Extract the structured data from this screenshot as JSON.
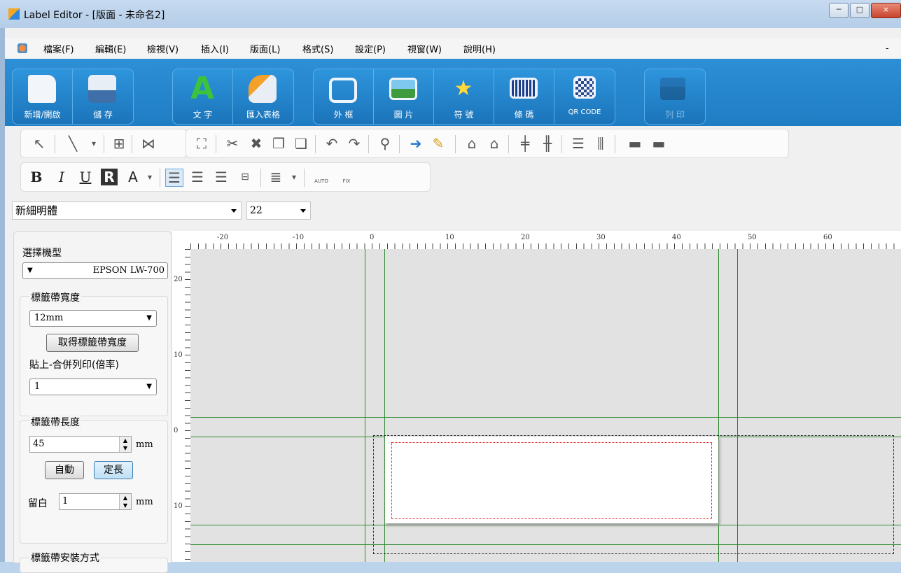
{
  "window": {
    "title": "Label Editor - [版面 - 未命名2]",
    "controls": [
      "─",
      "□",
      "×"
    ]
  },
  "menu": [
    "檔案(F)",
    "編輯(E)",
    "檢視(V)",
    "插入(I)",
    "版面(L)",
    "格式(S)",
    "設定(P)",
    "視窗(W)",
    "說明(H)"
  ],
  "ribbon": {
    "groups": [
      [
        {
          "label": "新增/開啟",
          "icon": "new-open-icon"
        },
        {
          "label": "儲 存",
          "icon": "save-icon"
        }
      ],
      [
        {
          "label": "文 字",
          "icon": "text-icon"
        },
        {
          "label": "匯入表格",
          "icon": "import-table-icon"
        }
      ],
      [
        {
          "label": "外 框",
          "icon": "frame-icon"
        },
        {
          "label": "圖 片",
          "icon": "picture-icon"
        },
        {
          "label": "符 號",
          "icon": "symbol-icon"
        },
        {
          "label": "條 碼",
          "icon": "barcode-icon"
        },
        {
          "label": "QR CODE",
          "icon": "qrcode-icon"
        }
      ],
      [
        {
          "label": "列 印",
          "icon": "print-icon"
        }
      ]
    ]
  },
  "format_bar": {
    "bold": "B",
    "italic": "I",
    "underline": "U",
    "font_color": "A",
    "auto": "AUTO",
    "fix": "FIX"
  },
  "font": {
    "family": "新細明體",
    "size": "22"
  },
  "panel": {
    "model_label": "選擇機型",
    "model_value": "EPSON LW-700",
    "tape_width_label": "標籤帶寬度",
    "tape_width_value": "12mm",
    "get_width_button": "取得標籤帶寬度",
    "paste_label": "貼上-合併列印(倍率)",
    "paste_value": "1",
    "tape_length_label": "標籤帶長度",
    "tape_length_value": "45",
    "unit": "mm",
    "auto_button": "自動",
    "fixed_button": "定長",
    "margin_label": "留白",
    "margin_value": "1",
    "install_label": "標籤帶安裝方式"
  },
  "ruler": {
    "h_labels": [
      "-20",
      "-10",
      "0",
      "10",
      "20",
      "30",
      "40",
      "50",
      "60"
    ],
    "v_labels": [
      "20",
      "10",
      "0",
      "10"
    ]
  }
}
